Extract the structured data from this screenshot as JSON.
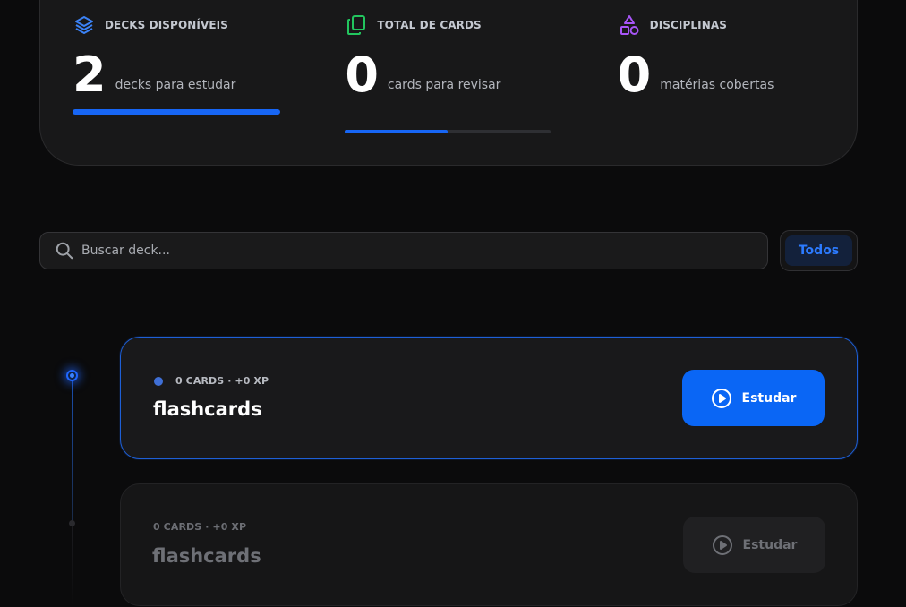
{
  "stats": [
    {
      "icon": "layers-icon",
      "label": "DECKS DISPONÍVEIS",
      "value": "2",
      "description": "decks para estudar",
      "progress": 1.0
    },
    {
      "icon": "copy-icon",
      "label": "TOTAL DE CARDS",
      "value": "0",
      "description": "cards para revisar",
      "progress": 0.5
    },
    {
      "icon": "shapes-icon",
      "label": "DISCIPLINAS",
      "value": "0",
      "description": "matérias cobertas"
    }
  ],
  "search": {
    "placeholder": "Buscar deck...",
    "value": ""
  },
  "filter": {
    "label": "Todos"
  },
  "decks": [
    {
      "meta": "0 CARDS · +0 XP",
      "title": "flashcards",
      "button": "Estudar"
    },
    {
      "meta": "0 CARDS · +0 XP",
      "title": "flashcards",
      "button": "Estudar"
    }
  ],
  "colors": {
    "accent": "#0a66f5",
    "background": "#0b0b0c",
    "card": "#19191b",
    "layers_icon": "#3b82f6",
    "copy_icon": "#22c55e",
    "shapes_icon": "#a855f7"
  }
}
